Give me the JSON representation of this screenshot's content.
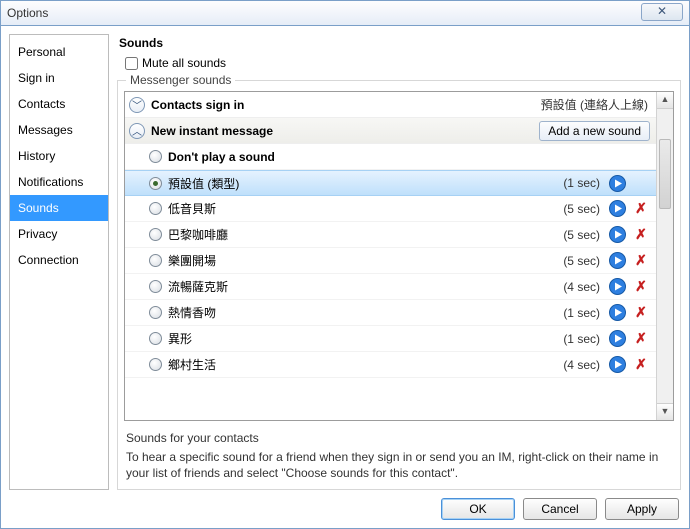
{
  "window": {
    "title": "Options",
    "close_glyph": "✕"
  },
  "sidebar": {
    "items": [
      {
        "label": "Personal"
      },
      {
        "label": "Sign in"
      },
      {
        "label": "Contacts"
      },
      {
        "label": "Messages"
      },
      {
        "label": "History"
      },
      {
        "label": "Notifications"
      },
      {
        "label": "Sounds"
      },
      {
        "label": "Privacy"
      },
      {
        "label": "Connection"
      }
    ],
    "selected_index": 6
  },
  "main": {
    "title": "Sounds",
    "mute_label": "Mute all sounds",
    "mute_checked": false,
    "fieldset_legend": "Messenger sounds",
    "group_contacts": {
      "label": "Contacts sign in",
      "value": "預設值 (連絡人上線)"
    },
    "group_im": {
      "label": "New instant message",
      "add_button": "Add a new sound"
    },
    "options": [
      {
        "label": "Don't play a sound",
        "bold": true,
        "duration": "",
        "has_play": false,
        "has_delete": false
      },
      {
        "label": "預設值 (類型)",
        "bold": false,
        "duration": "(1 sec)",
        "has_play": true,
        "has_delete": false
      },
      {
        "label": "低音貝斯",
        "bold": false,
        "duration": "(5 sec)",
        "has_play": true,
        "has_delete": true
      },
      {
        "label": "巴黎咖啡廳",
        "bold": false,
        "duration": "(5 sec)",
        "has_play": true,
        "has_delete": true
      },
      {
        "label": "樂團開場",
        "bold": false,
        "duration": "(5 sec)",
        "has_play": true,
        "has_delete": true
      },
      {
        "label": "流暢薩克斯",
        "bold": false,
        "duration": "(4 sec)",
        "has_play": true,
        "has_delete": true
      },
      {
        "label": "熱情香吻",
        "bold": false,
        "duration": "(1 sec)",
        "has_play": true,
        "has_delete": true
      },
      {
        "label": "異形",
        "bold": false,
        "duration": "(1 sec)",
        "has_play": true,
        "has_delete": true
      },
      {
        "label": "鄉村生活",
        "bold": false,
        "duration": "(4 sec)",
        "has_play": true,
        "has_delete": true
      }
    ],
    "selected_option_index": 1,
    "contacts_title": "Sounds for your contacts",
    "contacts_note": "To hear a specific sound for a friend when they sign in or send you an IM, right-click on their name in your list of friends and select \"Choose sounds for this contact\"."
  },
  "buttons": {
    "ok": "OK",
    "cancel": "Cancel",
    "apply": "Apply"
  },
  "glyphs": {
    "chev_down": "﹀",
    "chev_up": "︿",
    "up_arrow": "▲",
    "down_arrow": "▼",
    "delete": "✗"
  }
}
